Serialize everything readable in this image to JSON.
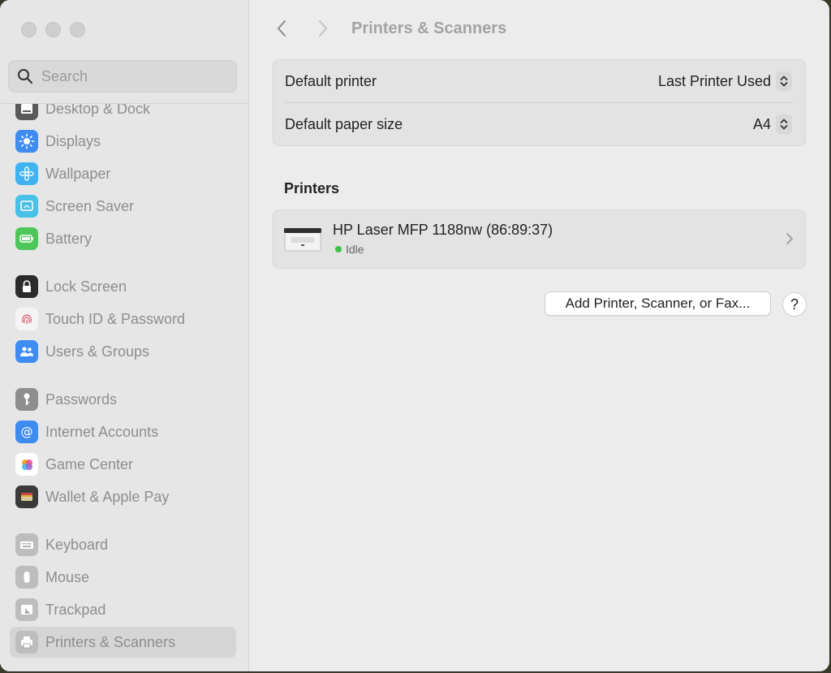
{
  "window": {
    "title": "Printers & Scanners"
  },
  "sidebar": {
    "search_placeholder": "Search",
    "items": [
      {
        "label": "Desktop & Dock",
        "icon": "dock-icon",
        "color": "#5a5a5a"
      },
      {
        "label": "Displays",
        "icon": "sun-icon",
        "color": "#3f8cf0"
      },
      {
        "label": "Wallpaper",
        "icon": "flower-icon",
        "color": "#3fb2f0"
      },
      {
        "label": "Screen Saver",
        "icon": "screensaver-icon",
        "color": "#49c0e8"
      },
      {
        "label": "Battery",
        "icon": "battery-icon",
        "color": "#4fc65a"
      },
      {
        "label": "Lock Screen",
        "icon": "lock-icon",
        "color": "#2b2b2b"
      },
      {
        "label": "Touch ID & Password",
        "icon": "fingerprint-icon",
        "color": "#f0f0f0"
      },
      {
        "label": "Users & Groups",
        "icon": "users-icon",
        "color": "#3f8cf0"
      },
      {
        "label": "Passwords",
        "icon": "key-icon",
        "color": "#8e8e8e"
      },
      {
        "label": "Internet Accounts",
        "icon": "at-icon",
        "color": "#3f8cf0"
      },
      {
        "label": "Game Center",
        "icon": "game-center-icon",
        "color": "#ffffff"
      },
      {
        "label": "Wallet & Apple Pay",
        "icon": "wallet-icon",
        "color": "#3a3a3a"
      },
      {
        "label": "Keyboard",
        "icon": "keyboard-icon",
        "color": "#a8a8a8"
      },
      {
        "label": "Mouse",
        "icon": "mouse-icon",
        "color": "#a8a8a8"
      },
      {
        "label": "Trackpad",
        "icon": "trackpad-icon",
        "color": "#a8a8a8"
      },
      {
        "label": "Printers & Scanners",
        "icon": "printer-icon",
        "color": "#a8a8a8",
        "selected": true
      }
    ]
  },
  "main": {
    "title": "Printers & Scanners",
    "defaults": [
      {
        "label": "Default printer",
        "value": "Last Printer Used"
      },
      {
        "label": "Default paper size",
        "value": "A4"
      }
    ],
    "printers_heading": "Printers",
    "printers": [
      {
        "name": "HP Laser MFP 1188nw (86:89:37)",
        "status": "Idle",
        "status_color": "#3fbf4a"
      }
    ],
    "add_button": "Add Printer, Scanner, or Fax...",
    "help_button": "?"
  }
}
